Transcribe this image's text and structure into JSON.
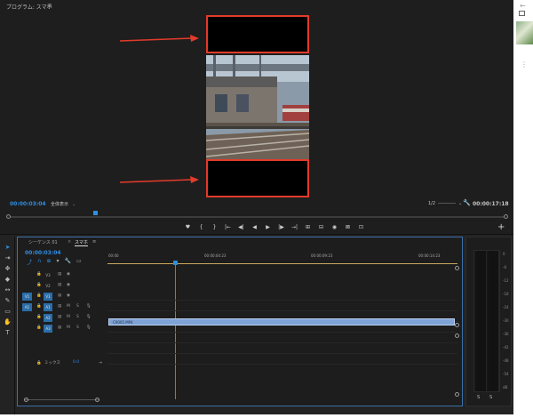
{
  "program": {
    "title": "プログラム: スマホ",
    "menu": "≡",
    "timecode_current": "00:00:03:04",
    "fit_select": "全体表示",
    "zoom_select": "1/2",
    "timecode_duration": "00:00:17:18"
  },
  "transport": [
    "♥",
    "{",
    "}",
    "|←",
    "◀|",
    "◀",
    "▶",
    "|▶",
    "→|",
    "⊞",
    "⊟",
    "◉",
    "⊠",
    "⊡"
  ],
  "timeline": {
    "tab1": "シーケンス 01",
    "tab2": "スマホ",
    "tab2_menu": "≡",
    "timecode": "00:00:03:04",
    "ruler": [
      "00:00",
      "00:00:04:23",
      "00:00:09:23",
      "00:00:14:23"
    ],
    "tracks": [
      {
        "name": "V3",
        "kind": "video"
      },
      {
        "name": "V2",
        "kind": "video"
      },
      {
        "name": "V1",
        "kind": "video",
        "source": "V1"
      },
      {
        "name": "A1",
        "kind": "audio",
        "source": "A1"
      },
      {
        "name": "A2",
        "kind": "audio"
      },
      {
        "name": "A3",
        "kind": "audio"
      }
    ],
    "mix_label": "ミックス",
    "mix_value": "0.0",
    "clip_label": "C0005.MP4"
  },
  "meter": {
    "scale": [
      "0",
      "-6",
      "-12",
      "-18",
      "-24",
      "-30",
      "-36",
      "-42",
      "-48",
      "-54",
      "dB"
    ],
    "solo_left": "S",
    "solo_right": "S"
  },
  "colors": {
    "accent": "#2f8ee0",
    "annotation_red": "#e23b2a",
    "clip": "#7fa3d6"
  }
}
